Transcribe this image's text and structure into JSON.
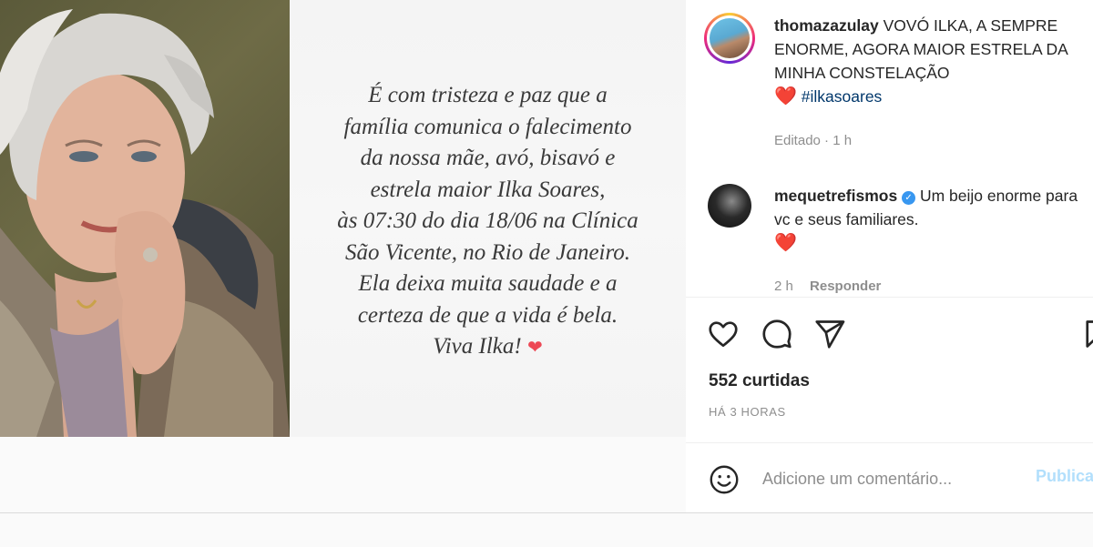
{
  "post": {
    "message_lines": [
      "É com tristeza e paz que a",
      "família comunica o falecimento",
      "da nossa mãe, avó, bisavó e",
      "estrela maior Ilka Soares,",
      "às 07:30 do dia 18/06  na Clínica",
      "São Vicente, no Rio de Janeiro.",
      "Ela deixa muita saudade e a",
      "certeza de que a vida é bela.",
      "Viva Ilka!"
    ],
    "message_heart": "❤"
  },
  "caption": {
    "username": "thomazazulay",
    "text": "VOVÓ ILKA, A SEMPRE ENORME, AGORA MAIOR ESTRELA DA MINHA CONSTELAÇÃO",
    "heart": "❤️",
    "hashtag": "#ilkasoares",
    "edited": "Editado",
    "time": "1 h"
  },
  "comment": {
    "username": "mequetrefismos",
    "verified_icon": "✓",
    "text": "Um beijo enorme para vc e seus familiares.",
    "heart": "❤️",
    "time": "2 h",
    "reply_label": "Responder"
  },
  "actions": {
    "likes": "552 curtidas",
    "timestamp": "HÁ 3 HORAS"
  },
  "add_comment": {
    "placeholder": "Adicione um comentário...",
    "publish_label": "Publicar"
  },
  "icons": [
    "heart-outline-icon",
    "comment-bubble-icon",
    "send-paper-plane-icon",
    "bookmark-icon",
    "emoji-smiley-icon"
  ],
  "colors": {
    "heart_red": "#ed4956",
    "hashtag_blue": "#00376b",
    "verified_blue": "#3897f0",
    "publish_disabled": "#b2dffc"
  }
}
